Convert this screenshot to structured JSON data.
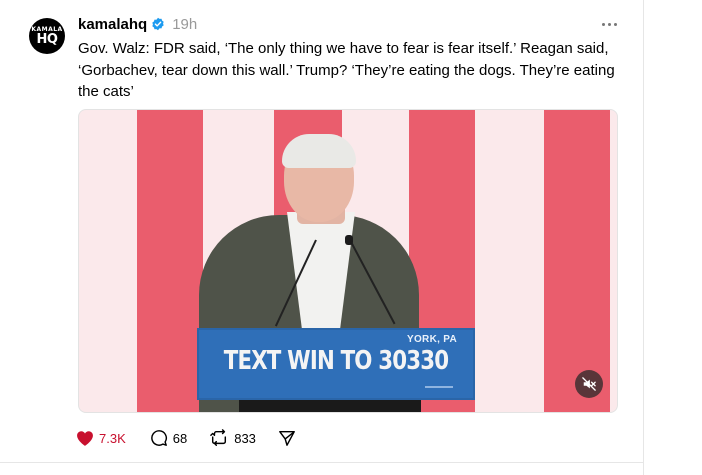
{
  "post": {
    "author": {
      "username": "kamalahq",
      "verified": true,
      "avatar_text_small": "KAMALA",
      "avatar_text_big": "HQ"
    },
    "time": "19h",
    "caption": "Gov. Walz: FDR said, ‘The only thing we have to fear is fear itself.’ Reagan said, ‘Gorbachev, tear down this wall.’ Trump? ‘They’re eating the dogs. They’re eating the cats’",
    "video": {
      "podium_subtext": "YORK, PA",
      "podium_text": "TEXT WIN TO 30330",
      "muted": true
    },
    "actions": {
      "likes": "7.3K",
      "replies": "68",
      "reposts": "833"
    }
  },
  "icons": {
    "more": "more-dots-icon",
    "verified": "verified-badge-icon",
    "like": "heart-icon",
    "reply": "comment-icon",
    "repost": "repost-icon",
    "share": "send-icon",
    "mute": "speaker-muted-icon"
  },
  "colors": {
    "like_active": "#c8102e",
    "verified_blue": "#1d9bf0",
    "stripe_red": "#ea5d6d",
    "podium_blue": "#2f6fb8"
  }
}
